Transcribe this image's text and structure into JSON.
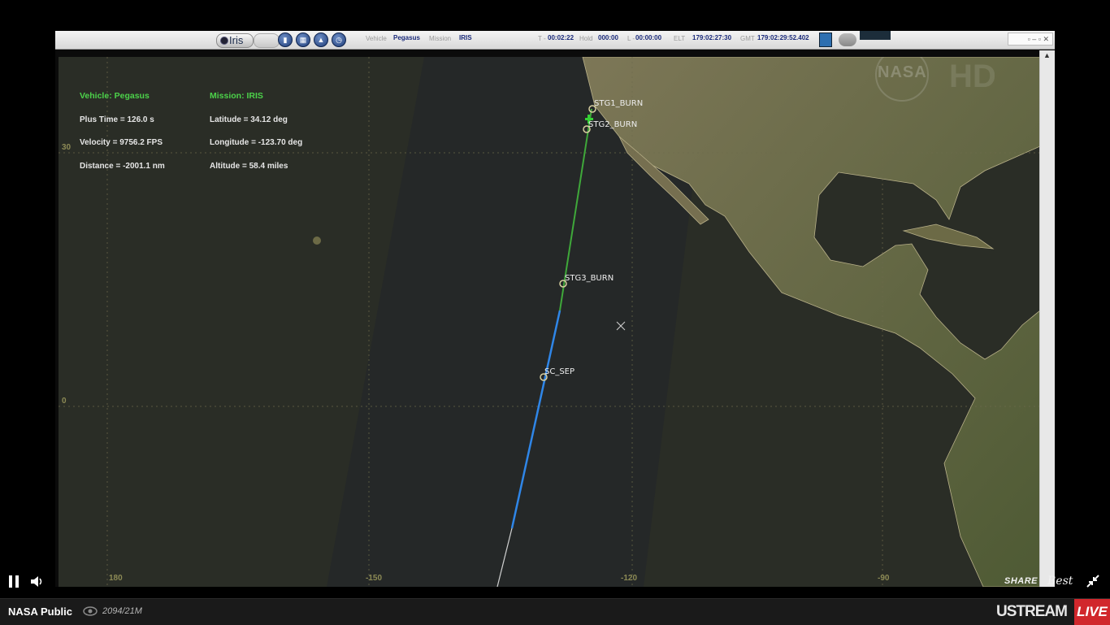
{
  "toolbar": {
    "app_name": "Iris",
    "vehicle_label": "Vehicle",
    "vehicle_value": "Pegasus",
    "mission_label": "Mission",
    "mission_value": "IRIS",
    "t_label": "T -",
    "t_value": "00:02:22",
    "hold_label": "Hold",
    "hold_value": "000:00",
    "l_label": "L -",
    "l_value": "00:00:00",
    "elt_label": "ELT",
    "elt_value": "179:02:27:30",
    "gmt_label": "GMT",
    "gmt_value": "179:02:29:52.402",
    "icons": [
      "chart-icon",
      "grid-icon",
      "satellite-icon",
      "clock-icon"
    ]
  },
  "info": {
    "vehicle_title": "Vehicle: Pegasus",
    "plus_time": "Plus Time = 126.0 s",
    "velocity": "Velocity = 9756.2 FPS",
    "distance": "Distance = -2001.1 nm",
    "mission_title": "Mission: IRIS",
    "latitude": "Latitude = 34.12 deg",
    "longitude": "Longitude = -123.70 deg",
    "altitude": "Altitude = 58.4 miles"
  },
  "map": {
    "events": [
      "STG1_BURN",
      "STG2_BURN",
      "STG3_BURN",
      "SC_SEP"
    ],
    "lat_ticks": [
      "30",
      "0"
    ],
    "lon_ticks": [
      "180",
      "-150",
      "-120",
      "-90"
    ],
    "watermark_logo": "NASA",
    "watermark_hd": "HD",
    "colors": {
      "trajectory_flown": "#3fa83a",
      "trajectory_planned": "#2f86e8",
      "ocean": "#2a2d26",
      "land": "#6e6a4c"
    }
  },
  "player": {
    "share_label": "SHARE",
    "quality_label": "Best",
    "channel_name": "NASA Public",
    "viewers": "2094/21M",
    "brand": "USTREAM",
    "live_label": "LIVE",
    "icons": [
      "pause-icon",
      "volume-icon",
      "eye-icon",
      "collapse-fullscreen-icon"
    ]
  }
}
